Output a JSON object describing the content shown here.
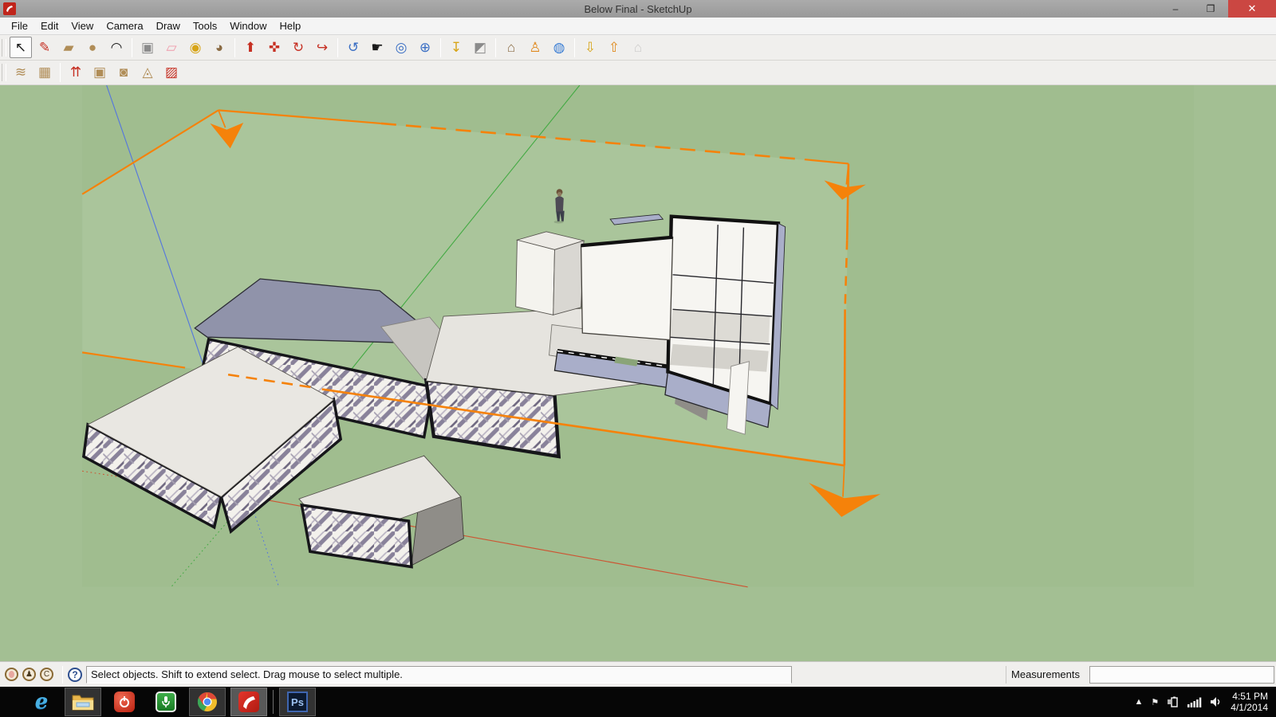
{
  "window": {
    "title": "Below Final - SketchUp",
    "controls": {
      "minimize": "–",
      "restore": "❐",
      "close": "✕"
    }
  },
  "menu": {
    "items": [
      "File",
      "Edit",
      "View",
      "Camera",
      "Draw",
      "Tools",
      "Window",
      "Help"
    ]
  },
  "toolbars": {
    "main": [
      {
        "id": "select",
        "glyph": "↖"
      },
      {
        "id": "line",
        "glyph": "✎"
      },
      {
        "id": "rectangle",
        "glyph": "▰"
      },
      {
        "id": "circle",
        "glyph": "●"
      },
      {
        "id": "arc",
        "glyph": "◠"
      },
      {
        "id": "make-component",
        "glyph": "▣"
      },
      {
        "id": "eraser",
        "glyph": "▱"
      },
      {
        "id": "tape-measure",
        "glyph": "◉"
      },
      {
        "id": "paint-bucket",
        "glyph": "◕"
      },
      {
        "id": "push-pull",
        "glyph": "⬆"
      },
      {
        "id": "move",
        "glyph": "✜"
      },
      {
        "id": "rotate",
        "glyph": "↻"
      },
      {
        "id": "offset",
        "glyph": "↪"
      },
      {
        "id": "orbit",
        "glyph": "↺"
      },
      {
        "id": "pan",
        "glyph": "☛"
      },
      {
        "id": "zoom",
        "glyph": "◎"
      },
      {
        "id": "zoom-extents",
        "glyph": "⊕"
      },
      {
        "id": "add-location",
        "glyph": "↧"
      },
      {
        "id": "toggle-terrain",
        "glyph": "◩"
      },
      {
        "id": "photo-textures",
        "glyph": "⌂"
      },
      {
        "id": "position-camera",
        "glyph": "♙"
      },
      {
        "id": "google-earth",
        "glyph": "◍"
      },
      {
        "id": "get-models",
        "glyph": "⇩"
      },
      {
        "id": "share-model",
        "glyph": "⇧"
      },
      {
        "id": "extension-warehouse",
        "glyph": "⌂"
      }
    ],
    "sandbox": [
      {
        "id": "from-contours",
        "glyph": "≋"
      },
      {
        "id": "from-scratch",
        "glyph": "▦"
      },
      {
        "id": "smoove",
        "glyph": "⇈"
      },
      {
        "id": "stamp",
        "glyph": "▣"
      },
      {
        "id": "drape",
        "glyph": "◙"
      },
      {
        "id": "add-detail",
        "glyph": "◬"
      },
      {
        "id": "flip-edge",
        "glyph": "▨"
      }
    ]
  },
  "viewport": {
    "scene": "3d-building-model-with-section-plane",
    "ground_color": "#a3bf93",
    "section_plane_color": "#f5820a",
    "roof_color": "#9093aa",
    "axis_colors": {
      "red_x": "#cc5533",
      "green_y": "#44aa44",
      "blue_z": "#5577dd"
    },
    "figures": [
      "scale-person"
    ]
  },
  "statusbar": {
    "geo_icons": [
      "geolocation",
      "credit",
      "copyright"
    ],
    "help_label": "?",
    "tip": "Select objects. Shift to extend select. Drag mouse to select multiple.",
    "measurements_label": "Measurements",
    "measurements_value": ""
  },
  "taskbar": {
    "apps": [
      {
        "id": "internet-explorer",
        "label": "e"
      },
      {
        "id": "file-explorer",
        "label": ""
      },
      {
        "id": "power",
        "label": ""
      },
      {
        "id": "microphone",
        "label": ""
      },
      {
        "id": "chrome",
        "label": ""
      },
      {
        "id": "sketchup",
        "label": "",
        "active": true
      },
      {
        "id": "photoshop",
        "label": "Ps"
      }
    ],
    "tray": {
      "hidden_icons": "▲",
      "flag": "⚑",
      "time": "4:51 PM",
      "date": "4/1/2014"
    }
  }
}
